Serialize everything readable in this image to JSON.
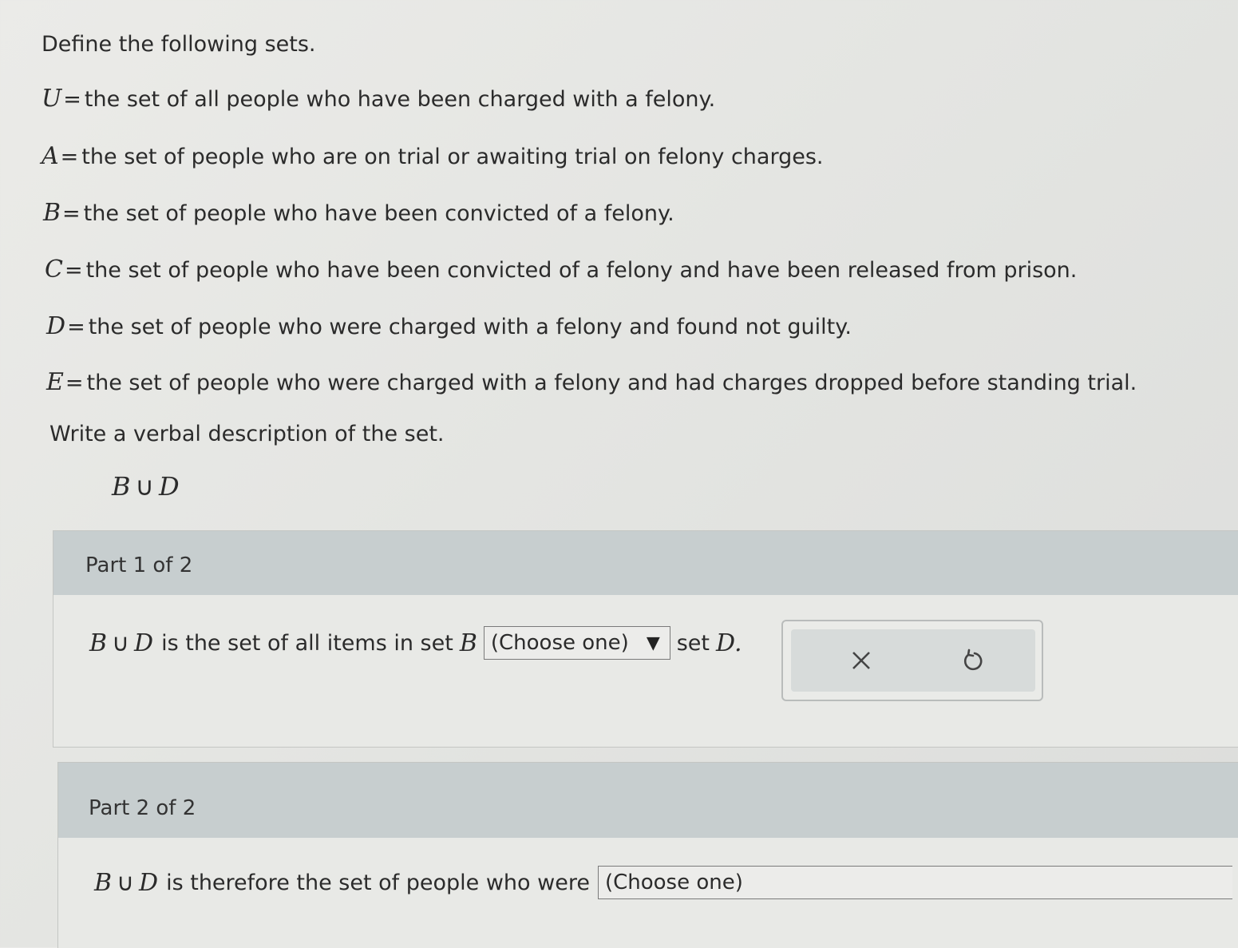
{
  "intro": "Define the following sets.",
  "definitions": [
    {
      "var": "U",
      "eq": "=",
      "text": "the set of all people who have been charged with a felony."
    },
    {
      "var": "A",
      "eq": "=",
      "text": "the set of people who are on trial or awaiting trial on felony charges."
    },
    {
      "var": "B",
      "eq": "=",
      "text": "the set of people who have been convicted of a felony."
    },
    {
      "var": "C",
      "eq": "=",
      "text": "the set of people who have been convicted of a felony and have been released from prison."
    },
    {
      "var": "D",
      "eq": "=",
      "text": "the set of people who were charged with a felony and found not guilty."
    },
    {
      "var": "E",
      "eq": "=",
      "text": "the set of people who were charged with a felony and had charges dropped before standing trial."
    }
  ],
  "prompt": "Write a verbal description of the set.",
  "expression": {
    "left": "B",
    "op": "∪",
    "right": "D"
  },
  "part1": {
    "header": "Part 1 of 2",
    "sentence_start": "is the set of all items in set",
    "set_b": "B",
    "dropdown_value": "(Choose one)",
    "dropdown_arrow": "▼",
    "sentence_end": "set",
    "set_d": "D.",
    "actions": {
      "clear_icon": "close-icon",
      "undo_icon": "undo-icon"
    }
  },
  "part2": {
    "header": "Part 2 of 2",
    "sentence": "is therefore the set of people who were",
    "dropdown_value": "(Choose one)"
  }
}
